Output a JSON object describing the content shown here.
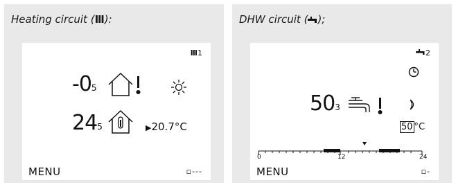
{
  "heating": {
    "caption": "Heating circuit (฿):",
    "caption_icon": "radiator-icon",
    "circuit_number": "1",
    "outdoor_value": "-0",
    "outdoor_decimal": "5",
    "flow_value": "24",
    "flow_decimal": "5",
    "desired_temp": "20.7°C",
    "mode_icon": "sun-icon",
    "menu_label": "MENU",
    "dots": "▫---"
  },
  "dhw": {
    "caption": "DHW circuit (═͟);",
    "caption_icon": "tap-icon",
    "circuit_number": "2",
    "temp_value": "50",
    "temp_decimal": "3",
    "setpoint": "50",
    "setpoint_unit": "°C",
    "menu_label": "MENU",
    "dots": "▫-",
    "timeline_labels": [
      "0",
      "12",
      "24"
    ],
    "mode_icons": [
      "clock-icon",
      "moon-icon"
    ]
  }
}
